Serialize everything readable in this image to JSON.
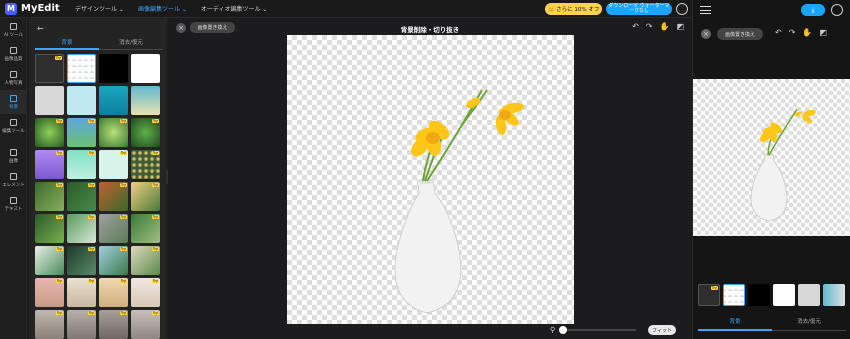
{
  "app": {
    "logo_letter": "M",
    "name": "MyEdit"
  },
  "nav": [
    "デザインツール ⌄",
    "画像編集ツール ⌄",
    "オーディオ編集ツール ⌄"
  ],
  "promo": "👑 さらに 10% オフ",
  "download": "ダウンロード ウォーターマークなし",
  "leftbar": [
    {
      "label": "AI ツール"
    },
    {
      "label": "画像品質"
    },
    {
      "label": "人物写真"
    },
    {
      "label": "背景"
    },
    {
      "label": "編集ツール"
    },
    {
      "label": "画像"
    },
    {
      "label": "エレメント"
    },
    {
      "label": "テキスト"
    }
  ],
  "panel": {
    "back": "←",
    "tabs": [
      "背景",
      "消去/復元"
    ],
    "try_label": "Try"
  },
  "editor": {
    "replace_button": "画像置き換え",
    "title": "背景削除・切り抜き",
    "fit_button": "フィット"
  },
  "right": {
    "replace_button": "画像置き換え",
    "tabs": [
      "背景",
      "消去/復元"
    ]
  },
  "colors": {
    "accent": "#3ba6ff",
    "download": "#19a6ff",
    "promo": "#ffd34d",
    "flower": "#ffc61a",
    "stem": "#6ea33a"
  },
  "icons": [
    "close-icon",
    "undo-icon",
    "redo-icon",
    "hand-icon",
    "compare-icon",
    "zoom-icon",
    "menu-icon",
    "download-icon",
    "user-icon"
  ]
}
